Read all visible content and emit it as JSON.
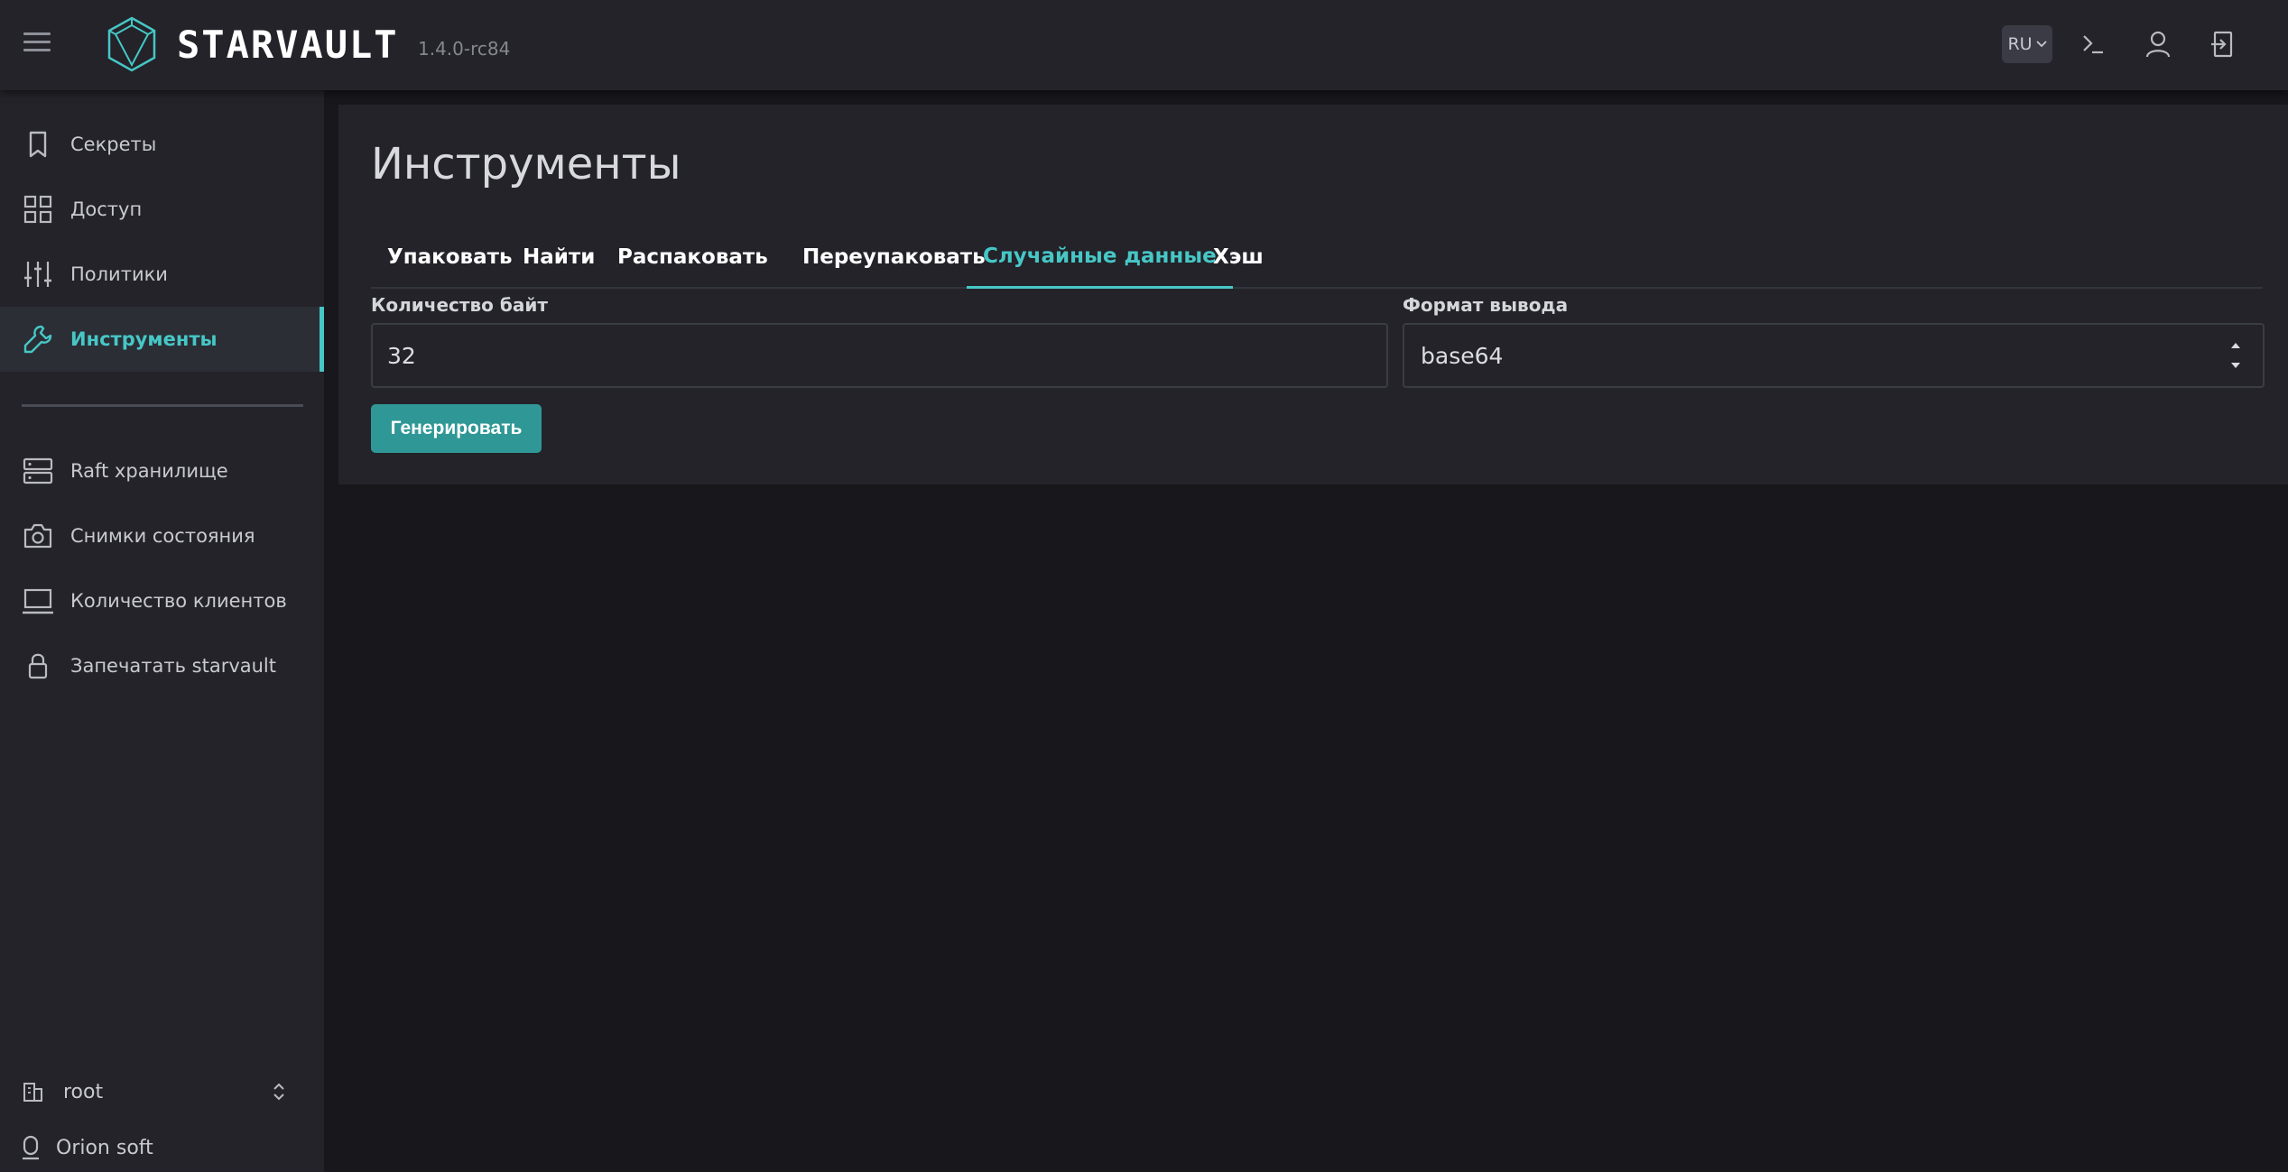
{
  "header": {
    "brand": "STARVAULT",
    "version": "1.4.0-rc84",
    "language": "RU"
  },
  "sidebar": {
    "items": [
      {
        "label": "Секреты",
        "icon": "bookmark-icon"
      },
      {
        "label": "Доступ",
        "icon": "grid-icon"
      },
      {
        "label": "Политики",
        "icon": "sliders-icon"
      },
      {
        "label": "Инструменты",
        "icon": "wrench-icon",
        "active": true
      },
      {
        "label": "Raft хранилище",
        "icon": "server-icon"
      },
      {
        "label": "Снимки состояния",
        "icon": "camera-icon"
      },
      {
        "label": "Количество клиентов",
        "icon": "monitor-icon"
      },
      {
        "label": "Запечатать starvault",
        "icon": "lock-icon"
      }
    ],
    "namespace": "root",
    "vendor": "Orion soft"
  },
  "main": {
    "title": "Инструменты",
    "tabs": [
      {
        "label": "Упаковать"
      },
      {
        "label": "Найти"
      },
      {
        "label": "Распаковать"
      },
      {
        "label": "Переупаковать"
      },
      {
        "label": "Случайные данные",
        "active": true
      },
      {
        "label": "Хэш"
      }
    ],
    "bytes_label": "Количество байт",
    "bytes_value": "32",
    "format_label": "Формат вывода",
    "format_value": "base64",
    "generate_label": "Генерировать"
  },
  "colors": {
    "accent": "#46c7c6",
    "button": "#2f9896",
    "panel": "#232329",
    "background": "#17171c"
  }
}
